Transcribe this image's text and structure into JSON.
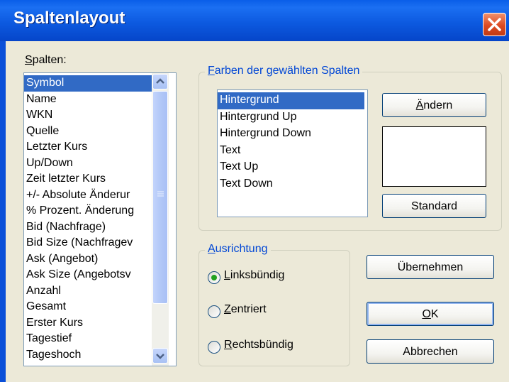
{
  "dialog": {
    "title": "Spaltenlayout",
    "close_icon": "close-icon"
  },
  "columns": {
    "label_accel": "S",
    "label_rest": "palten:",
    "items": [
      {
        "label": "Symbol",
        "selected": true
      },
      {
        "label": "Name"
      },
      {
        "label": "WKN"
      },
      {
        "label": "Quelle"
      },
      {
        "label": "Letzter Kurs"
      },
      {
        "label": "Up/Down"
      },
      {
        "label": "Zeit letzter Kurs"
      },
      {
        "label": "+/- Absolute Änderur"
      },
      {
        "label": "% Prozent. Änderung"
      },
      {
        "label": "Bid (Nachfrage)"
      },
      {
        "label": "Bid Size (Nachfragev"
      },
      {
        "label": "Ask (Angebot)"
      },
      {
        "label": "Ask Size (Angebotsv"
      },
      {
        "label": "Anzahl"
      },
      {
        "label": "Gesamt"
      },
      {
        "label": "Erster Kurs"
      },
      {
        "label": "Tagestief"
      },
      {
        "label": "Tageshoch"
      }
    ]
  },
  "colors_group": {
    "legend_accel": "F",
    "legend_rest": "arben der gewählten Spalten",
    "items": [
      {
        "label": "Hintergrund",
        "selected": true
      },
      {
        "label": "Hintergrund Up"
      },
      {
        "label": "Hintergrund Down"
      },
      {
        "label": "Text"
      },
      {
        "label": "Text Up"
      },
      {
        "label": "Text Down"
      }
    ],
    "change_accel": "Ä",
    "change_rest": "ndern",
    "standard_label": "Standard",
    "preview_color": "#ffffff"
  },
  "alignment": {
    "legend_accel": "A",
    "legend_rest": "usrichtung",
    "options": [
      {
        "accel": "L",
        "rest": "inksbündig",
        "checked": true
      },
      {
        "accel": "Z",
        "rest": "entriert",
        "checked": false
      },
      {
        "accel": "R",
        "rest": "echtsbündig",
        "checked": false
      }
    ]
  },
  "buttons": {
    "apply_label": "Übernehmen",
    "ok_accel": "O",
    "ok_rest": "K",
    "cancel_label": "Abbrechen"
  },
  "colors": {
    "selection": "#316ac5",
    "titlebar": "#0a5ee8",
    "face": "#ece9d8"
  }
}
